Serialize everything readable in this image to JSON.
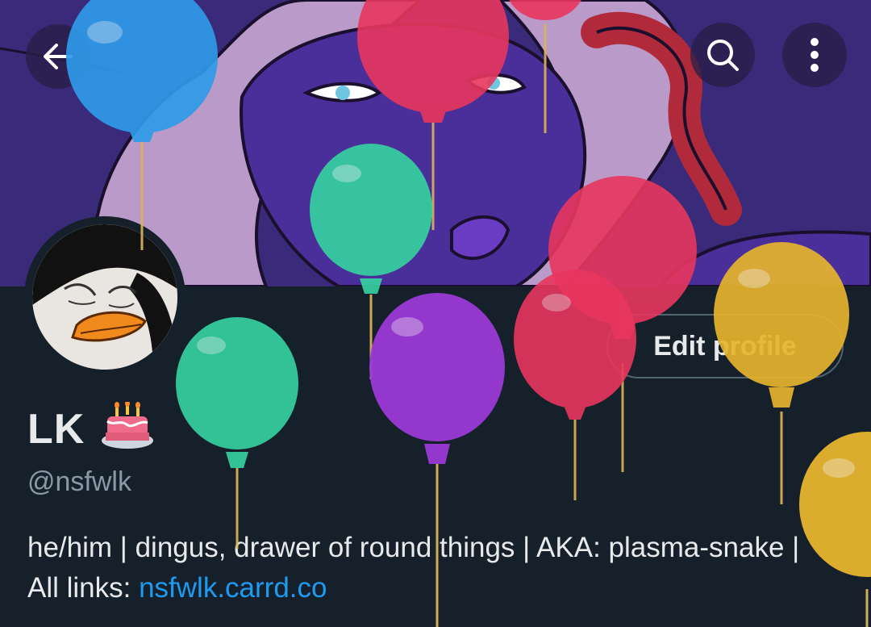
{
  "profile": {
    "display_name": "LK",
    "handle": "@nsfwlk",
    "bio_text": "he/him | dingus, drawer of round things | AKA: plasma-snake | All links: ",
    "bio_link": "nsfwlk.carrd.co"
  },
  "actions": {
    "edit_profile_label": "Edit profile"
  },
  "icons": {
    "back": "arrow-left-icon",
    "search": "search-icon",
    "more": "more-vertical-icon",
    "birthday": "birthday-cake-icon"
  },
  "colors": {
    "background": "#15202b",
    "banner": "#3a2a7a",
    "text": "#e7e9ea",
    "secondary_text": "#8b98a5",
    "link": "#1d9bf0",
    "balloon_colors": [
      "#2f9ae8",
      "#e8365e",
      "#36d0a0",
      "#9b3ad6",
      "#e6b42e"
    ]
  }
}
